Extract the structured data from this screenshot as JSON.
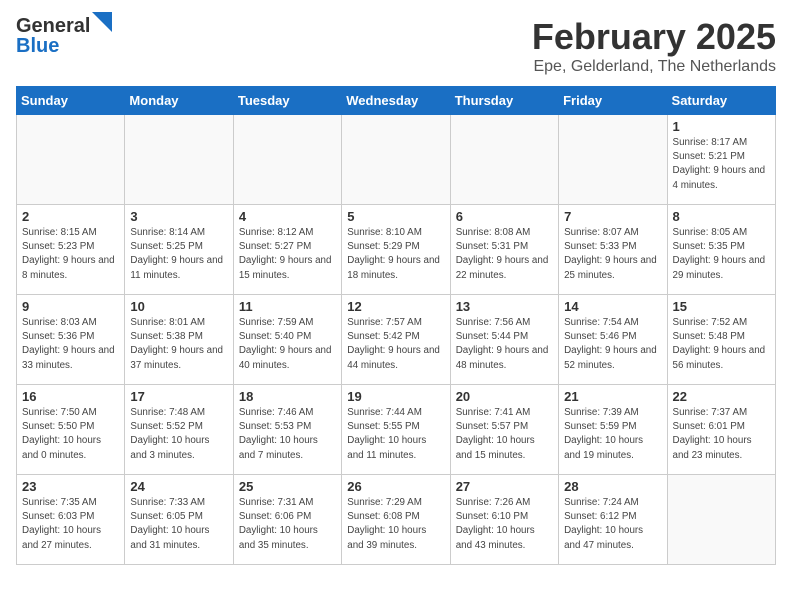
{
  "header": {
    "logo_general": "General",
    "logo_blue": "Blue",
    "month_year": "February 2025",
    "location": "Epe, Gelderland, The Netherlands"
  },
  "weekdays": [
    "Sunday",
    "Monday",
    "Tuesday",
    "Wednesday",
    "Thursday",
    "Friday",
    "Saturday"
  ],
  "weeks": [
    [
      {
        "day": "",
        "info": ""
      },
      {
        "day": "",
        "info": ""
      },
      {
        "day": "",
        "info": ""
      },
      {
        "day": "",
        "info": ""
      },
      {
        "day": "",
        "info": ""
      },
      {
        "day": "",
        "info": ""
      },
      {
        "day": "1",
        "info": "Sunrise: 8:17 AM\nSunset: 5:21 PM\nDaylight: 9 hours and 4 minutes."
      }
    ],
    [
      {
        "day": "2",
        "info": "Sunrise: 8:15 AM\nSunset: 5:23 PM\nDaylight: 9 hours and 8 minutes."
      },
      {
        "day": "3",
        "info": "Sunrise: 8:14 AM\nSunset: 5:25 PM\nDaylight: 9 hours and 11 minutes."
      },
      {
        "day": "4",
        "info": "Sunrise: 8:12 AM\nSunset: 5:27 PM\nDaylight: 9 hours and 15 minutes."
      },
      {
        "day": "5",
        "info": "Sunrise: 8:10 AM\nSunset: 5:29 PM\nDaylight: 9 hours and 18 minutes."
      },
      {
        "day": "6",
        "info": "Sunrise: 8:08 AM\nSunset: 5:31 PM\nDaylight: 9 hours and 22 minutes."
      },
      {
        "day": "7",
        "info": "Sunrise: 8:07 AM\nSunset: 5:33 PM\nDaylight: 9 hours and 25 minutes."
      },
      {
        "day": "8",
        "info": "Sunrise: 8:05 AM\nSunset: 5:35 PM\nDaylight: 9 hours and 29 minutes."
      }
    ],
    [
      {
        "day": "9",
        "info": "Sunrise: 8:03 AM\nSunset: 5:36 PM\nDaylight: 9 hours and 33 minutes."
      },
      {
        "day": "10",
        "info": "Sunrise: 8:01 AM\nSunset: 5:38 PM\nDaylight: 9 hours and 37 minutes."
      },
      {
        "day": "11",
        "info": "Sunrise: 7:59 AM\nSunset: 5:40 PM\nDaylight: 9 hours and 40 minutes."
      },
      {
        "day": "12",
        "info": "Sunrise: 7:57 AM\nSunset: 5:42 PM\nDaylight: 9 hours and 44 minutes."
      },
      {
        "day": "13",
        "info": "Sunrise: 7:56 AM\nSunset: 5:44 PM\nDaylight: 9 hours and 48 minutes."
      },
      {
        "day": "14",
        "info": "Sunrise: 7:54 AM\nSunset: 5:46 PM\nDaylight: 9 hours and 52 minutes."
      },
      {
        "day": "15",
        "info": "Sunrise: 7:52 AM\nSunset: 5:48 PM\nDaylight: 9 hours and 56 minutes."
      }
    ],
    [
      {
        "day": "16",
        "info": "Sunrise: 7:50 AM\nSunset: 5:50 PM\nDaylight: 10 hours and 0 minutes."
      },
      {
        "day": "17",
        "info": "Sunrise: 7:48 AM\nSunset: 5:52 PM\nDaylight: 10 hours and 3 minutes."
      },
      {
        "day": "18",
        "info": "Sunrise: 7:46 AM\nSunset: 5:53 PM\nDaylight: 10 hours and 7 minutes."
      },
      {
        "day": "19",
        "info": "Sunrise: 7:44 AM\nSunset: 5:55 PM\nDaylight: 10 hours and 11 minutes."
      },
      {
        "day": "20",
        "info": "Sunrise: 7:41 AM\nSunset: 5:57 PM\nDaylight: 10 hours and 15 minutes."
      },
      {
        "day": "21",
        "info": "Sunrise: 7:39 AM\nSunset: 5:59 PM\nDaylight: 10 hours and 19 minutes."
      },
      {
        "day": "22",
        "info": "Sunrise: 7:37 AM\nSunset: 6:01 PM\nDaylight: 10 hours and 23 minutes."
      }
    ],
    [
      {
        "day": "23",
        "info": "Sunrise: 7:35 AM\nSunset: 6:03 PM\nDaylight: 10 hours and 27 minutes."
      },
      {
        "day": "24",
        "info": "Sunrise: 7:33 AM\nSunset: 6:05 PM\nDaylight: 10 hours and 31 minutes."
      },
      {
        "day": "25",
        "info": "Sunrise: 7:31 AM\nSunset: 6:06 PM\nDaylight: 10 hours and 35 minutes."
      },
      {
        "day": "26",
        "info": "Sunrise: 7:29 AM\nSunset: 6:08 PM\nDaylight: 10 hours and 39 minutes."
      },
      {
        "day": "27",
        "info": "Sunrise: 7:26 AM\nSunset: 6:10 PM\nDaylight: 10 hours and 43 minutes."
      },
      {
        "day": "28",
        "info": "Sunrise: 7:24 AM\nSunset: 6:12 PM\nDaylight: 10 hours and 47 minutes."
      },
      {
        "day": "",
        "info": ""
      }
    ]
  ]
}
